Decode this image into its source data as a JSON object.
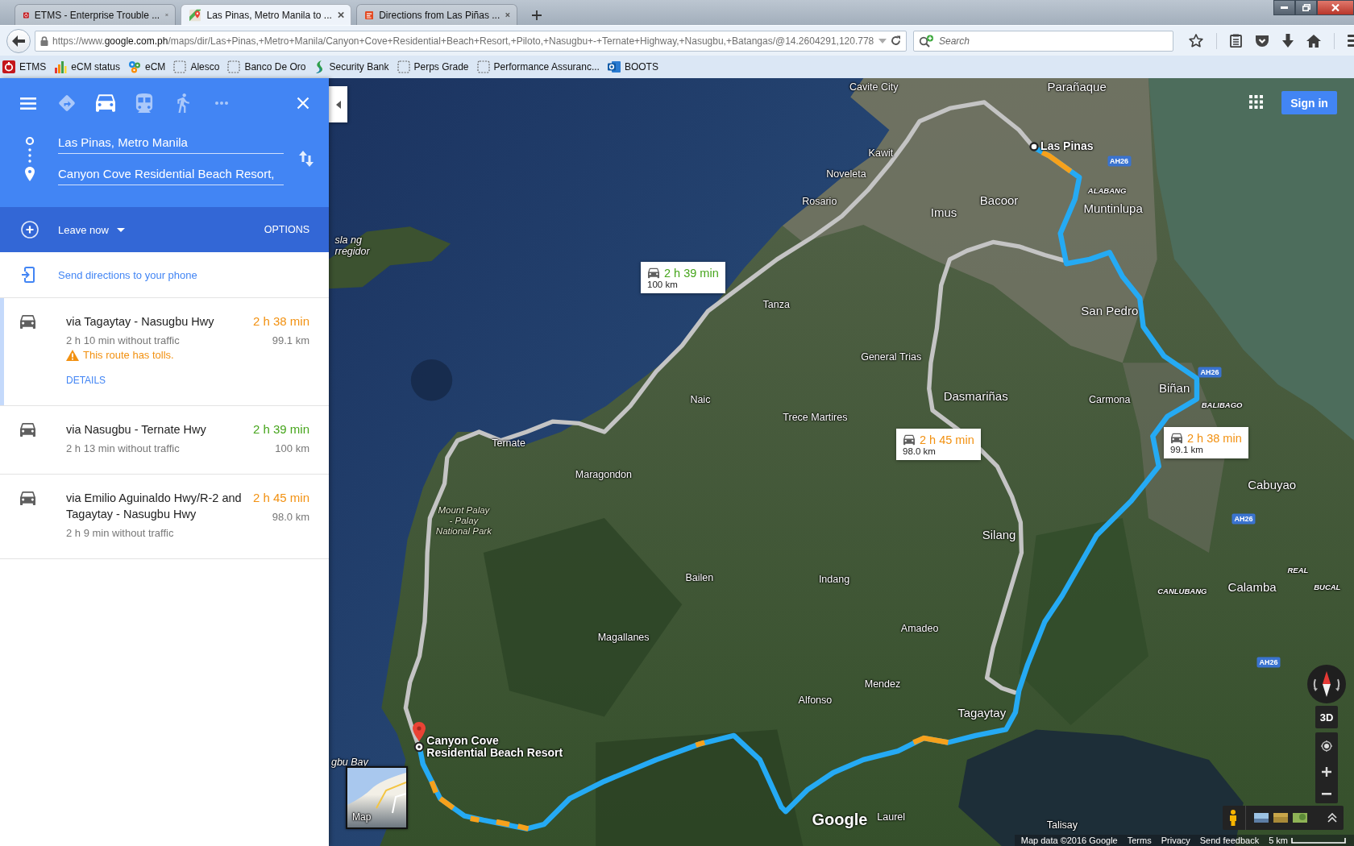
{
  "browser": {
    "tabs": [
      {
        "title": "ETMS - Enterprise Trouble ...",
        "kind": "etms",
        "selected": false
      },
      {
        "title": "Las Pinas, Metro Manila to ...",
        "kind": "maps",
        "selected": true
      },
      {
        "title": "Directions from Las Piñas ...",
        "kind": "directions",
        "selected": false
      }
    ],
    "url": "https://www.**google.com.ph**/maps/dir/Las+Pinas,+Metro+Manila/Canyon+Cove+Residential+Beach+Resort,+Piloto,+Nasugbu+-+Ternate+Highway,+Nasugbu,+Batangas/@14.2604291,120.778",
    "search": {
      "placeholder": "Search"
    },
    "bookmarks": [
      {
        "label": "ETMS",
        "kind": "etms"
      },
      {
        "label": "eCM status",
        "kind": "chart"
      },
      {
        "label": "eCM",
        "kind": "gears"
      },
      {
        "label": "Alesco",
        "kind": "blank"
      },
      {
        "label": "Banco De Oro",
        "kind": "blank"
      },
      {
        "label": "Security Bank",
        "kind": "swoosh"
      },
      {
        "label": "Perps Grade",
        "kind": "blank"
      },
      {
        "label": "Performance Assuranc...",
        "kind": "blank"
      },
      {
        "label": "BOOTS",
        "kind": "tile"
      }
    ]
  },
  "directions": {
    "modes": [
      {
        "kind": "best",
        "selected": false
      },
      {
        "kind": "drive",
        "selected": true
      },
      {
        "kind": "transit",
        "selected": false
      },
      {
        "kind": "walk",
        "selected": false
      }
    ],
    "origin": {
      "value": "Las Pinas, Metro Manila"
    },
    "destination": {
      "value": "Canyon Cove Residential Beach Resort,"
    },
    "departure": "Leave now",
    "options": "OPTIONS",
    "send_to_phone": "Send directions to your phone",
    "routes": [
      {
        "name": "via Tagaytay - Nasugbu Hwy",
        "duration": "2 h 38 min",
        "color": "#f29111",
        "typical": "2 h 10 min without traffic",
        "distance": "99.1 km",
        "warning": "This route has tolls.",
        "details": "DETAILS",
        "selected": true
      },
      {
        "name": "via Nasugbu - Ternate Hwy",
        "duration": "2 h 39 min",
        "color": "#46a51c",
        "typical": "2 h 13 min without traffic",
        "distance": "100 km",
        "selected": false
      },
      {
        "name": "via Emilio Aguinaldo Hwy/R-2 and Tagaytay - Nasugbu Hwy",
        "duration": "2 h 45 min",
        "color": "#f29111",
        "typical": "2 h 9 min without traffic",
        "distance": "98.0 km",
        "selected": false
      }
    ]
  },
  "map": {
    "sign_in": "Sign in",
    "labels": [
      {
        "kind": "town",
        "lines": [
          "Cavite City"
        ]
      },
      {
        "kind": "city",
        "lines": [
          "Parañaque"
        ]
      },
      {
        "kind": "town",
        "lines": [
          "Kawit"
        ]
      },
      {
        "kind": "shield",
        "lines": [
          "AH26"
        ]
      },
      {
        "kind": "town",
        "lines": [
          "Noveleta"
        ]
      },
      {
        "kind": "town",
        "lines": [
          "Rosario"
        ]
      },
      {
        "kind": "city",
        "lines": [
          "Imus"
        ]
      },
      {
        "kind": "city",
        "lines": [
          "Bacoor"
        ]
      },
      {
        "kind": "district",
        "lines": [
          "ALABANG"
        ]
      },
      {
        "kind": "city",
        "lines": [
          "Muntinlupa"
        ]
      },
      {
        "kind": "water",
        "lines": [
          "sla ng",
          "rregidor"
        ]
      },
      {
        "kind": "town",
        "lines": [
          "Tanza"
        ]
      },
      {
        "kind": "city",
        "lines": [
          "San Pedro"
        ]
      },
      {
        "kind": "town",
        "lines": [
          "General Trias"
        ]
      },
      {
        "kind": "shield",
        "lines": [
          "AH26"
        ]
      },
      {
        "kind": "town",
        "lines": [
          "Naic"
        ]
      },
      {
        "kind": "city",
        "lines": [
          "Dasmariñas"
        ]
      },
      {
        "kind": "town",
        "lines": [
          "Carmona"
        ]
      },
      {
        "kind": "city",
        "lines": [
          "Biñan"
        ]
      },
      {
        "kind": "district",
        "lines": [
          "BALIBAGO"
        ]
      },
      {
        "kind": "town",
        "lines": [
          "Trece Martires"
        ]
      },
      {
        "kind": "town",
        "lines": [
          "Ternate"
        ]
      },
      {
        "kind": "town",
        "lines": [
          "Maragondon"
        ]
      },
      {
        "kind": "city",
        "lines": [
          "Cabuyao"
        ]
      },
      {
        "kind": "park",
        "lines": [
          "Mount Palay",
          "- Palay",
          "National Park"
        ]
      },
      {
        "kind": "shield",
        "lines": [
          "AH26"
        ]
      },
      {
        "kind": "city",
        "lines": [
          "Silang"
        ]
      },
      {
        "kind": "town",
        "lines": [
          "Bailen"
        ]
      },
      {
        "kind": "town",
        "lines": [
          "Indang"
        ]
      },
      {
        "kind": "district",
        "lines": [
          "REAL"
        ]
      },
      {
        "kind": "district",
        "lines": [
          "CANLUBANG"
        ]
      },
      {
        "kind": "city",
        "lines": [
          "Calamba"
        ]
      },
      {
        "kind": "district",
        "lines": [
          "BUCAL"
        ]
      },
      {
        "kind": "town",
        "lines": [
          "Magallanes"
        ]
      },
      {
        "kind": "town",
        "lines": [
          "Amadeo"
        ]
      },
      {
        "kind": "shield",
        "lines": [
          "AH26"
        ]
      },
      {
        "kind": "town",
        "lines": [
          "Mendez"
        ]
      },
      {
        "kind": "town",
        "lines": [
          "Alfonso"
        ]
      },
      {
        "kind": "city",
        "lines": [
          "Tagaytay"
        ]
      },
      {
        "kind": "water",
        "lines": [
          "gbu Bay"
        ]
      },
      {
        "kind": "town",
        "lines": [
          "Laurel"
        ]
      },
      {
        "kind": "town",
        "lines": [
          "Talisay"
        ]
      }
    ],
    "markers": [
      {
        "kind": "origin",
        "lines": [
          "Las Pinas"
        ]
      },
      {
        "kind": "destination",
        "lines": [
          "Canyon Cove",
          "Residential Beach Resort"
        ]
      }
    ],
    "callouts": [
      {
        "duration": "2 h 39 min",
        "distance": "100 km",
        "color": "#46a51c"
      },
      {
        "duration": "2 h 45 min",
        "distance": "98.0 km",
        "color": "#f29111"
      },
      {
        "duration": "2 h 38 min",
        "distance": "99.1 km",
        "color": "#f29111"
      }
    ],
    "tilt": "3D",
    "thumbnail": "Map",
    "logo": "Google",
    "attribution": "Map data ©2016 Google",
    "links": [
      "Terms",
      "Privacy",
      "Send feedback"
    ],
    "scale": "5 km"
  }
}
